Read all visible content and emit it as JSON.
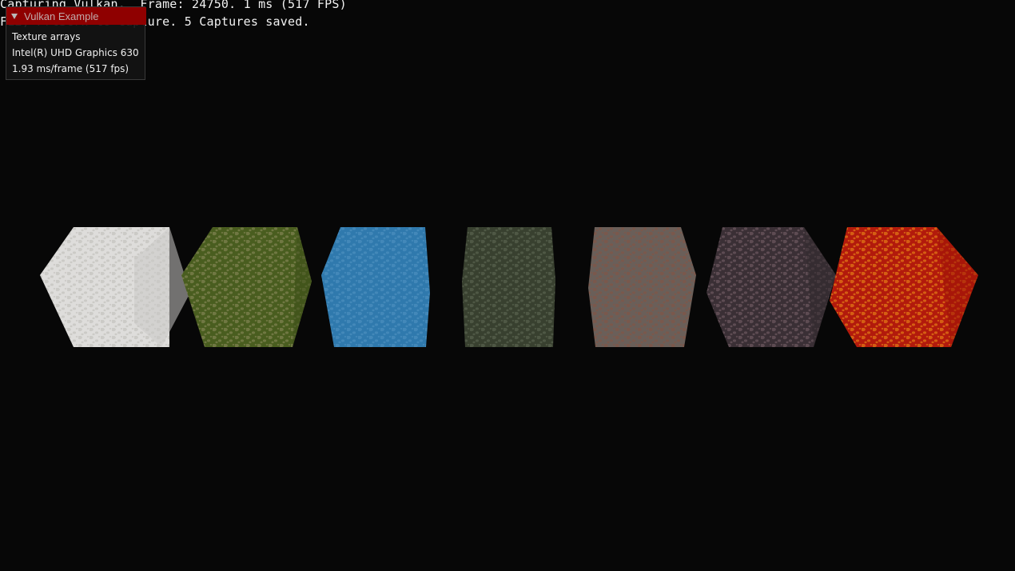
{
  "app": {
    "window_title": "Vulkan Example",
    "background": "#070707"
  },
  "overlay": {
    "line1": "Capturing Vulkan.  Frame: 24750. 1 ms (517 FPS)",
    "line2": "F12, PrtScrn to capture. 5 Captures saved."
  },
  "imgui": {
    "title": "Vulkan Example",
    "title_bar_color": "#8f0000",
    "lines": [
      "Texture arrays",
      "Intel(R) UHD Graphics 630",
      "1.93 ms/frame (517 fps)"
    ]
  },
  "cubes": [
    {
      "name": "snow-cube",
      "colors": {
        "main": "#dedddb",
        "top": "#ebeae8",
        "side": "#cbc9c6",
        "accent": "#b5b3ae"
      }
    },
    {
      "name": "grass-cube",
      "colors": {
        "main": "#495d1f",
        "top": "#53682a",
        "side": "#3d4f18",
        "accent": "#a09a6f"
      }
    },
    {
      "name": "water-cube",
      "colors": {
        "main": "#2f79ad",
        "top": "#3583ba",
        "side": "#286c9d",
        "accent": "#5b9bc8"
      }
    },
    {
      "name": "rock-cube",
      "colors": {
        "main": "#38402f",
        "top": "#424a37",
        "side": "#2f3627",
        "accent": "#6a7560"
      }
    },
    {
      "name": "stone-layers-cube",
      "colors": {
        "main": "#6a5f59",
        "top": "#786b63",
        "side": "#5b514c",
        "accent": "#8e4f3c"
      }
    },
    {
      "name": "gravel-cube",
      "colors": {
        "main": "#3a2f35",
        "top": "#43383e",
        "side": "#32292e",
        "accent": "#8a6f77"
      }
    },
    {
      "name": "lava-cube",
      "colors": {
        "main": "#b21a0c",
        "top": "#c8240f",
        "side": "#9e1408",
        "accent": "#ffb21a"
      }
    }
  ]
}
